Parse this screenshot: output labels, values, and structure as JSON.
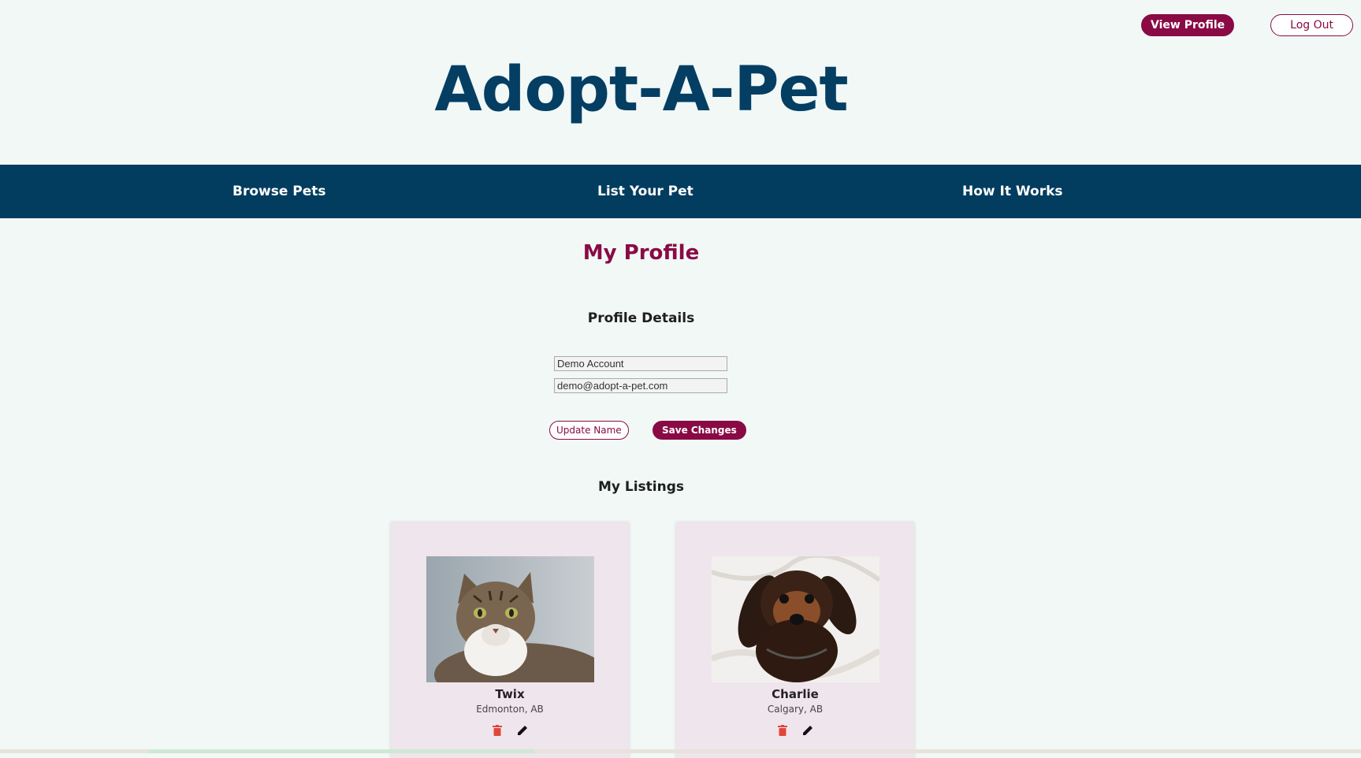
{
  "header": {
    "logo": "Adopt-A-Pet",
    "view_profile": "View Profile",
    "log_out": "Log Out"
  },
  "nav": {
    "items": [
      "Browse Pets",
      "List Your Pet",
      "How It Works"
    ]
  },
  "page": {
    "title": "My Profile",
    "profile_section": "Profile Details",
    "name_value": "Demo Account",
    "email_value": "demo@adopt-a-pet.com",
    "update_name": "Update Name",
    "save_changes": "Save Changes",
    "listings_section": "My Listings"
  },
  "listings": [
    {
      "name": "Twix",
      "location": "Edmonton, AB"
    },
    {
      "name": "Charlie",
      "location": "Calgary, AB"
    }
  ],
  "colors": {
    "brand_primary": "#8a0a45",
    "nav_background": "#023c5f",
    "logo_color": "#043e63",
    "page_background": "#f1f8f6",
    "card_background": "#efe5ec",
    "delete_icon": "#e0463a"
  },
  "icons": {
    "delete": "trash-icon",
    "edit": "pencil-icon"
  }
}
